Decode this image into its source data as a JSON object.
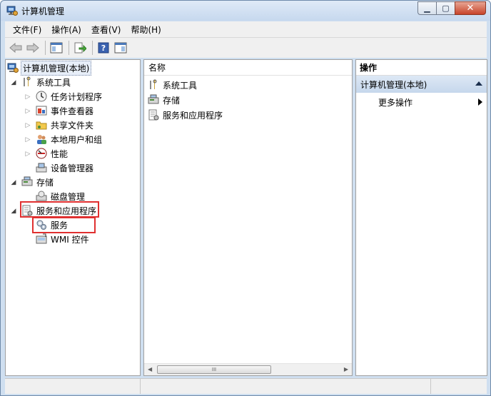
{
  "window": {
    "title": "计算机管理"
  },
  "menu": [
    "文件(F)",
    "操作(A)",
    "查看(V)",
    "帮助(H)"
  ],
  "tree": {
    "root": "计算机管理(本地)",
    "system_tools": "系统工具",
    "task_scheduler": "任务计划程序",
    "event_viewer": "事件查看器",
    "shared_folders": "共享文件夹",
    "local_users": "本地用户和组",
    "performance": "性能",
    "device_manager": "设备管理器",
    "storage": "存储",
    "disk_management": "磁盘管理",
    "services_apps": "服务和应用程序",
    "services": "服务",
    "wmi": "WMI 控件"
  },
  "content": {
    "column_header": "名称",
    "items": [
      "系统工具",
      "存储",
      "服务和应用程序"
    ]
  },
  "actions": {
    "title": "操作",
    "section": "计算机管理(本地)",
    "more": "更多操作"
  },
  "scrollbar_grip": "III",
  "colors": {
    "highlight_box": "#e03030",
    "action_header": "#c6d7ec"
  }
}
